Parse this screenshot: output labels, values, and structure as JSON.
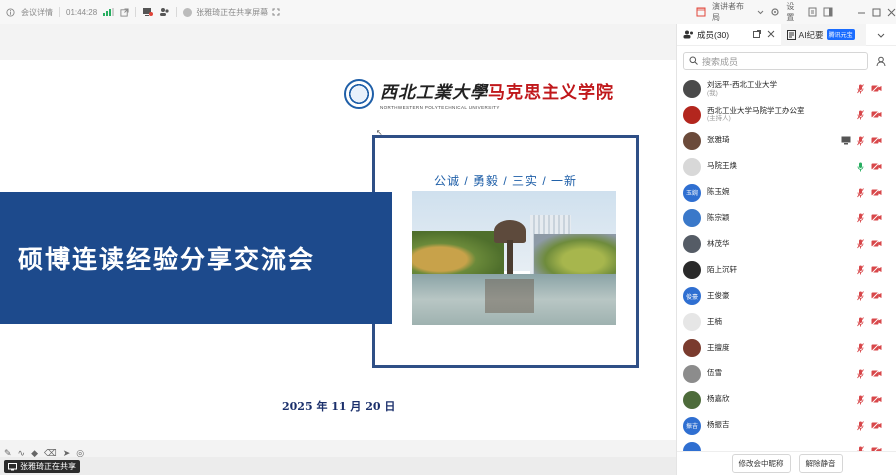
{
  "topbar": {
    "meeting_details": "会议详情",
    "elapsed": "01:44:28",
    "sharing_label": "张雅琦正在共享屏幕"
  },
  "right_top": {
    "speaker_layout": "演讲者布局",
    "settings": "设置"
  },
  "slide": {
    "logo_cn_black": "西北工業大學",
    "logo_cn_red": "马克思主义学院",
    "logo_en": "NORTHWESTERN POLYTECHNICAL UNIVERSITY",
    "motto": "公诚 / 勇毅 / 三实 / 一新",
    "title": "硕博连读经验分享交流会",
    "date": "2025 年 11 月 20 日"
  },
  "share_tag": "张雅琦正在共享",
  "panel": {
    "tab_members": "成员(30)",
    "tab_ai": "AI纪要",
    "tab_ai_badge": "腾讯元宝",
    "search_placeholder": "搜索成员",
    "members": [
      {
        "name": "刘远平-西北工业大学",
        "role": "(我)",
        "avatar_color": "#4a4a4a",
        "avatar_text": "",
        "mic": "muted",
        "screen": false
      },
      {
        "name": "西北工业大学马院学工办公室",
        "role": "(主持人)",
        "avatar_color": "#b3261e",
        "avatar_text": "",
        "mic": "muted",
        "screen": false
      },
      {
        "name": "张雅琦",
        "role": "",
        "avatar_color": "#6b4a3a",
        "avatar_text": "",
        "mic": "muted",
        "screen": true
      },
      {
        "name": "马院王焕",
        "role": "",
        "avatar_color": "#d8d8d8",
        "avatar_text": "",
        "mic": "active",
        "screen": false
      },
      {
        "name": "陈玉婉",
        "role": "",
        "avatar_color": "#2f6fd1",
        "avatar_text": "玉婉",
        "mic": "muted",
        "screen": false
      },
      {
        "name": "陈宗颖",
        "role": "",
        "avatar_color": "#3a78c9",
        "avatar_text": "",
        "mic": "muted",
        "screen": false
      },
      {
        "name": "林茂华",
        "role": "",
        "avatar_color": "#555c66",
        "avatar_text": "",
        "mic": "muted",
        "screen": false
      },
      {
        "name": "陌上沉轩",
        "role": "",
        "avatar_color": "#2a2a2a",
        "avatar_text": "",
        "mic": "muted",
        "screen": false
      },
      {
        "name": "王俊豪",
        "role": "",
        "avatar_color": "#2f6fd1",
        "avatar_text": "俊豪",
        "mic": "muted",
        "screen": false
      },
      {
        "name": "王楠",
        "role": "",
        "avatar_color": "#e6e6e6",
        "avatar_text": "",
        "mic": "muted",
        "screen": false
      },
      {
        "name": "王擅度",
        "role": "",
        "avatar_color": "#7a3b2e",
        "avatar_text": "",
        "mic": "muted",
        "screen": false
      },
      {
        "name": "伍雪",
        "role": "",
        "avatar_color": "#8c8c8c",
        "avatar_text": "",
        "mic": "muted",
        "screen": false
      },
      {
        "name": "杨嘉欣",
        "role": "",
        "avatar_color": "#4d6b3a",
        "avatar_text": "",
        "mic": "muted",
        "screen": false
      },
      {
        "name": "杨振吉",
        "role": "",
        "avatar_color": "#2f6fd1",
        "avatar_text": "振吉",
        "mic": "muted",
        "screen": false
      },
      {
        "name": "",
        "role": "",
        "avatar_color": "#2f6fd1",
        "avatar_text": "",
        "mic": "muted",
        "screen": false
      }
    ],
    "btn_rename": "修改会中昵称",
    "btn_unmute": "解除静音"
  },
  "colors": {
    "brand_blue": "#1d4a8c",
    "frame_blue": "#2f4f86",
    "logo_red": "#c0181b",
    "muted_red": "#d8474a",
    "active_green": "#27ae60"
  }
}
